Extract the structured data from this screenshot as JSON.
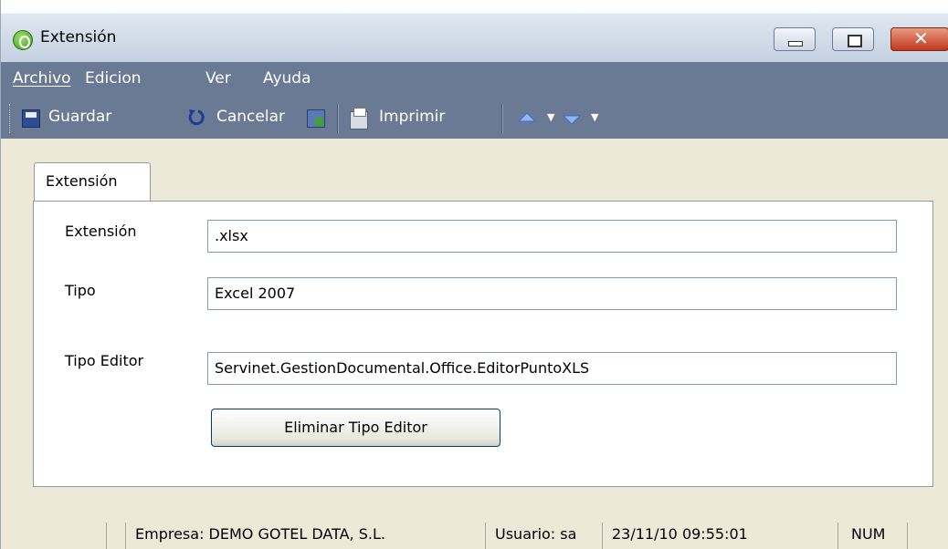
{
  "window": {
    "title": "Extensión",
    "close_glyph": "✕"
  },
  "menu": {
    "items": [
      {
        "label": "Archivo",
        "underline": "A"
      },
      {
        "label": "Edicion",
        "underline": "E"
      },
      {
        "label": "Ver",
        "underline": "V"
      },
      {
        "label": "Ayuda",
        "underline": "y"
      }
    ]
  },
  "toolbar": {
    "save_label": "Guardar",
    "cancel_label": "Cancelar",
    "print_label": "Imprimir",
    "icons": [
      "save-icon",
      "undo-icon",
      "export-icon",
      "printer-icon",
      "arrow-up-icon",
      "arrow-down-icon"
    ]
  },
  "tab": {
    "label": "Extensión"
  },
  "form": {
    "extension_label": "Extensión",
    "extension_value": ".xlsx",
    "tipo_label": "Tipo",
    "tipo_value": "Excel 2007",
    "editor_label": "Tipo Editor",
    "editor_value": "Servinet.GestionDocumental.Office.EditorPuntoXLS",
    "delete_button": "Eliminar Tipo Editor"
  },
  "status": {
    "empresa": "Empresa: DEMO GOTEL DATA, S.L.",
    "usuario": "Usuario: sa",
    "datetime": "23/11/10 09:55:01",
    "num": "NUM"
  },
  "colors": {
    "menubar": "#6a7a95",
    "titlebar": "#c5d2e2",
    "background": "#ece9d8",
    "close_button": "#c3371c"
  }
}
